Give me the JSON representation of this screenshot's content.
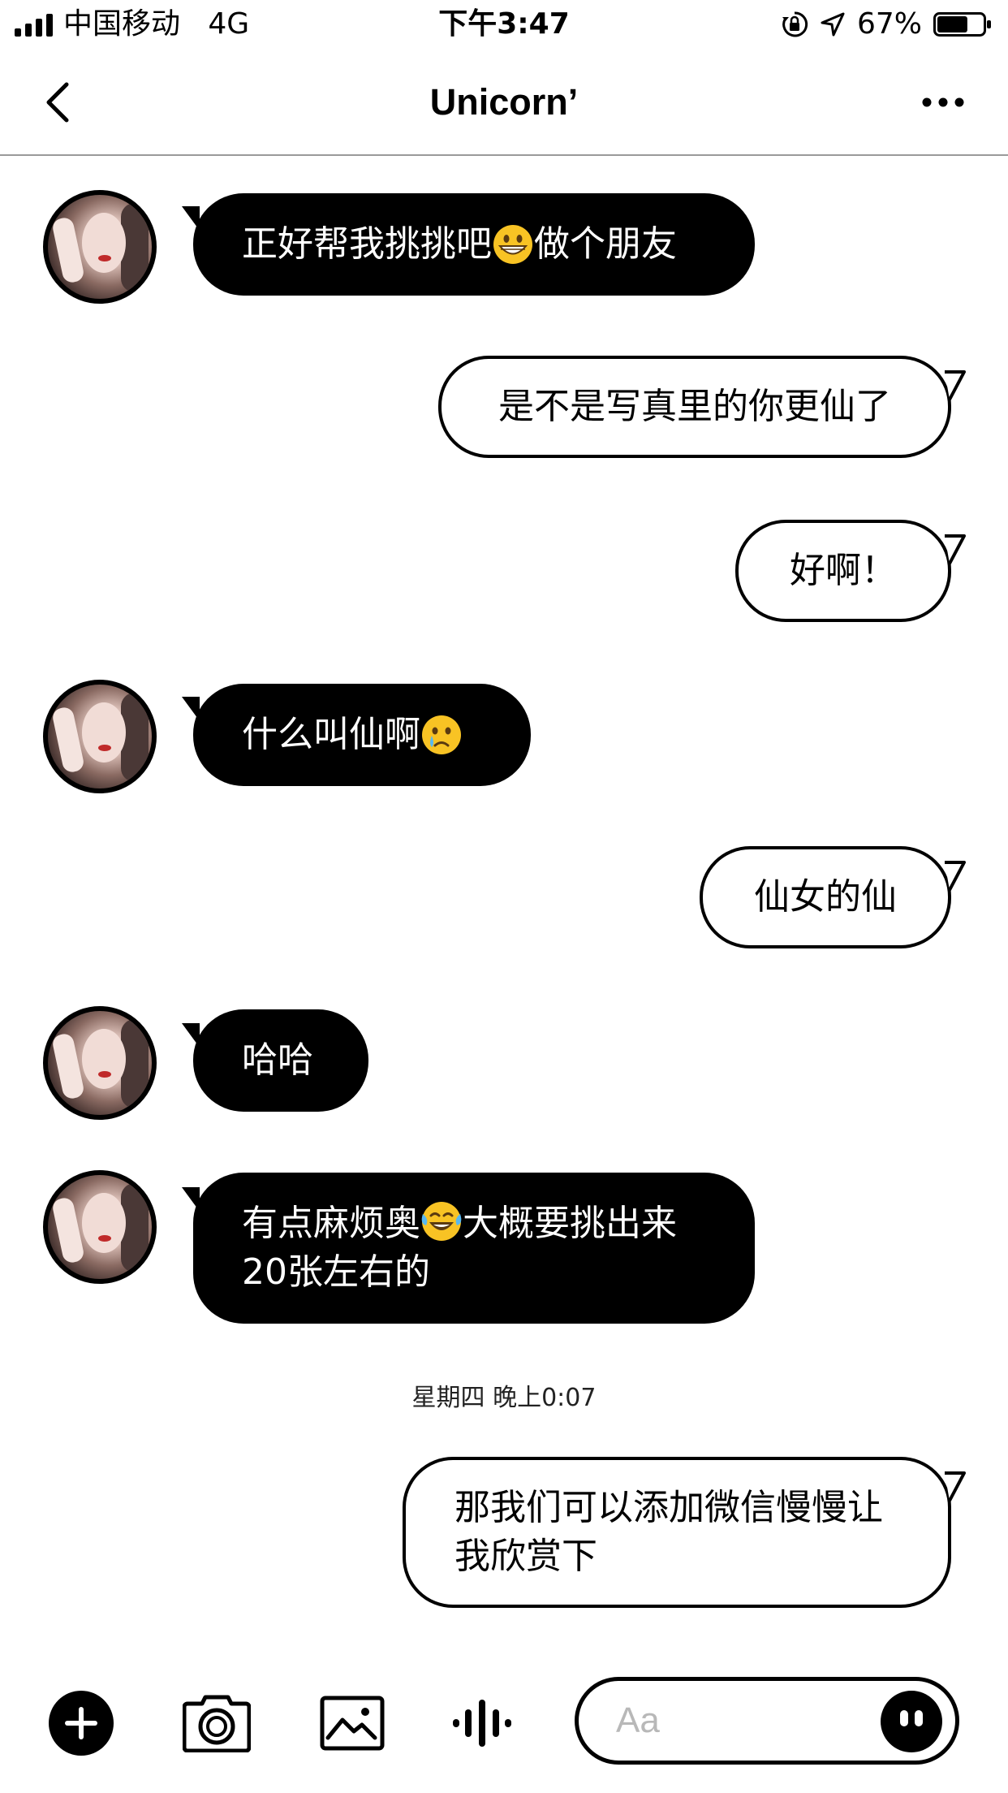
{
  "status_bar": {
    "carrier": "中国移动",
    "network": "4G",
    "time": "下午3:47",
    "battery_percent": "67%",
    "battery_level": 0.67,
    "icons": [
      "signal-bars-icon",
      "orientation-lock-icon",
      "location-arrow-icon",
      "battery-icon"
    ]
  },
  "header": {
    "title": "Unicorn’",
    "back_icon": "chevron-left-icon",
    "more_icon": "more-dots-icon"
  },
  "messages": [
    {
      "from": "them",
      "text": "正好帮我挑挑吧",
      "emoji": "grinning-face-icon",
      "text_after": "做个朋友"
    },
    {
      "from": "me",
      "text": "是不是写真里的你更仙了"
    },
    {
      "from": "me",
      "text": "好啊！"
    },
    {
      "from": "them",
      "text": "什么叫仙啊",
      "emoji": "crying-face-icon"
    },
    {
      "from": "me",
      "text": "仙女的仙"
    },
    {
      "from": "them",
      "text": "哈哈"
    },
    {
      "from": "them",
      "text": "有点麻烦奥",
      "emoji": "tears-of-joy-icon",
      "text_after": "大概要挑出来\n20张左右的"
    },
    {
      "from": "me",
      "text": "那我们可以添加微信慢慢让\n我欣赏下"
    }
  ],
  "timestamp": "星期四 晚上0:07",
  "composer": {
    "placeholder": "Aa",
    "value": "",
    "tools": [
      "plus-circle-icon",
      "camera-icon",
      "image-icon",
      "voice-wave-icon"
    ],
    "sticker_icon": "sticker-face-icon"
  },
  "colors": {
    "incoming_bubble": "#000000",
    "outgoing_bubble": "#ffffff",
    "text_on_dark": "#ffffff",
    "divider": "#9a9a9a"
  }
}
